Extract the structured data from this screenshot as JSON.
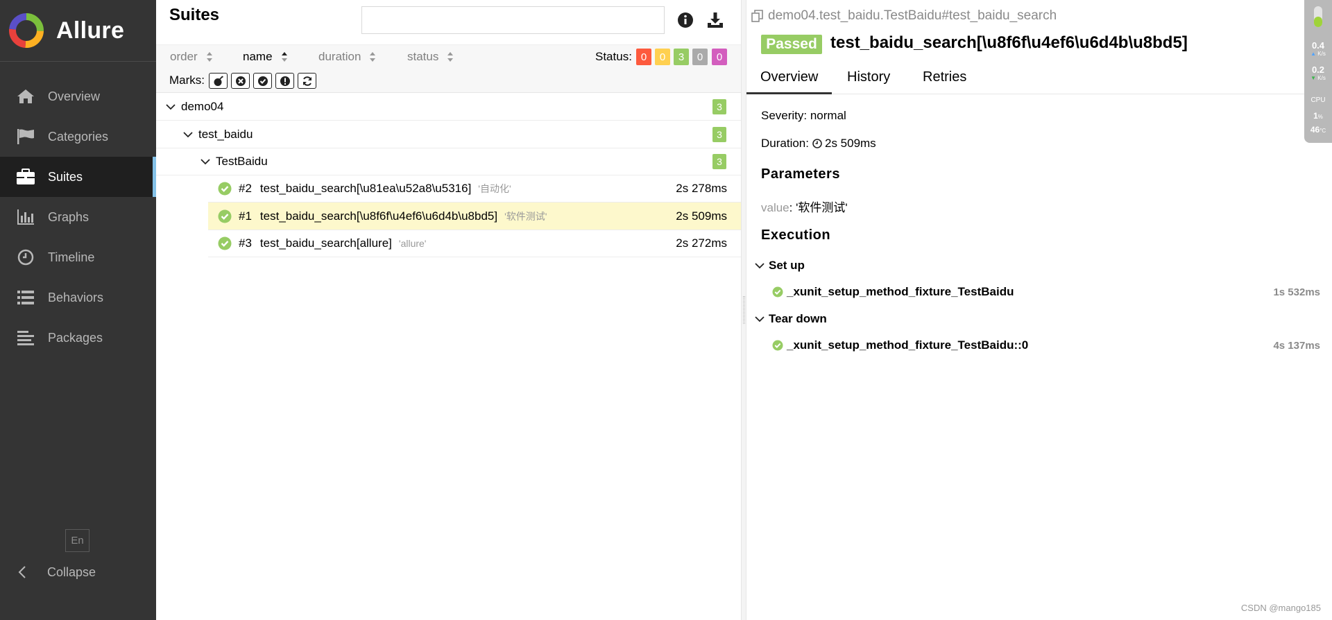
{
  "app": {
    "name": "Allure"
  },
  "sidebar": {
    "items": [
      {
        "label": "Overview",
        "icon": "home-icon",
        "active": false
      },
      {
        "label": "Categories",
        "icon": "flag-icon",
        "active": false
      },
      {
        "label": "Suites",
        "icon": "briefcase-icon",
        "active": true
      },
      {
        "label": "Graphs",
        "icon": "bar-chart-icon",
        "active": false
      },
      {
        "label": "Timeline",
        "icon": "clock-icon",
        "active": false
      },
      {
        "label": "Behaviors",
        "icon": "list-icon",
        "active": false
      },
      {
        "label": "Packages",
        "icon": "align-left-icon",
        "active": false
      }
    ],
    "lang": "En",
    "collapse_label": "Collapse"
  },
  "suites": {
    "title": "Suites",
    "search_placeholder": "",
    "sort": [
      {
        "label": "order",
        "active": false
      },
      {
        "label": "name",
        "active": true
      },
      {
        "label": "duration",
        "active": false
      },
      {
        "label": "status",
        "active": false
      }
    ],
    "status_label": "Status:",
    "status_counts": [
      {
        "value": "0",
        "color": "#fd5a3e",
        "status": "failed"
      },
      {
        "value": "0",
        "color": "#ffd050",
        "status": "broken"
      },
      {
        "value": "3",
        "color": "#97cc64",
        "status": "passed"
      },
      {
        "value": "0",
        "color": "#aaaaaa",
        "status": "skipped"
      },
      {
        "value": "0",
        "color": "#d35ebe",
        "status": "unknown"
      }
    ],
    "marks_label": "Marks:",
    "tree": [
      {
        "label": "demo04",
        "count": "3"
      },
      {
        "label": "test_baidu",
        "count": "3"
      },
      {
        "label": "TestBaidu",
        "count": "3"
      }
    ],
    "tests": [
      {
        "num": "#2",
        "name": "test_baidu_search[\\u81ea\\u52a8\\u5316]",
        "param": "'自动化'",
        "duration": "2s 278ms",
        "selected": false
      },
      {
        "num": "#1",
        "name": "test_baidu_search[\\u8f6f\\u4ef6\\u6d4b\\u8bd5]",
        "param": "'软件测试'",
        "duration": "2s 509ms",
        "selected": true
      },
      {
        "num": "#3",
        "name": "test_baidu_search[allure]",
        "param": "'allure'",
        "duration": "2s 272ms",
        "selected": false
      }
    ]
  },
  "detail": {
    "breadcrumb": "demo04.test_baidu.TestBaidu#test_baidu_search",
    "status": "Passed",
    "title": "test_baidu_search[\\u8f6f\\u4ef6\\u6d4b\\u8bd5]",
    "tabs": [
      "Overview",
      "History",
      "Retries"
    ],
    "severity": "Severity: normal",
    "duration_label": "Duration:",
    "duration": "2s 509ms",
    "parameters_heading": "Parameters",
    "param_key": "value",
    "param_value": ": '软件测试'",
    "execution_heading": "Execution",
    "setup_label": "Set up",
    "setup_step": {
      "name": "_xunit_setup_method_fixture_TestBaidu",
      "duration": "1s 532ms"
    },
    "teardown_label": "Tear down",
    "teardown_step": {
      "name": "_xunit_setup_method_fixture_TestBaidu::0",
      "duration": "4s 137ms"
    }
  },
  "monitor": {
    "up": "0.4",
    "down": "0.2",
    "unit": "K/s",
    "cpu_label": "CPU",
    "cpu": "1",
    "cpu_unit": "%",
    "temp": "46",
    "temp_unit": "°C"
  },
  "watermark": "CSDN @mango185"
}
